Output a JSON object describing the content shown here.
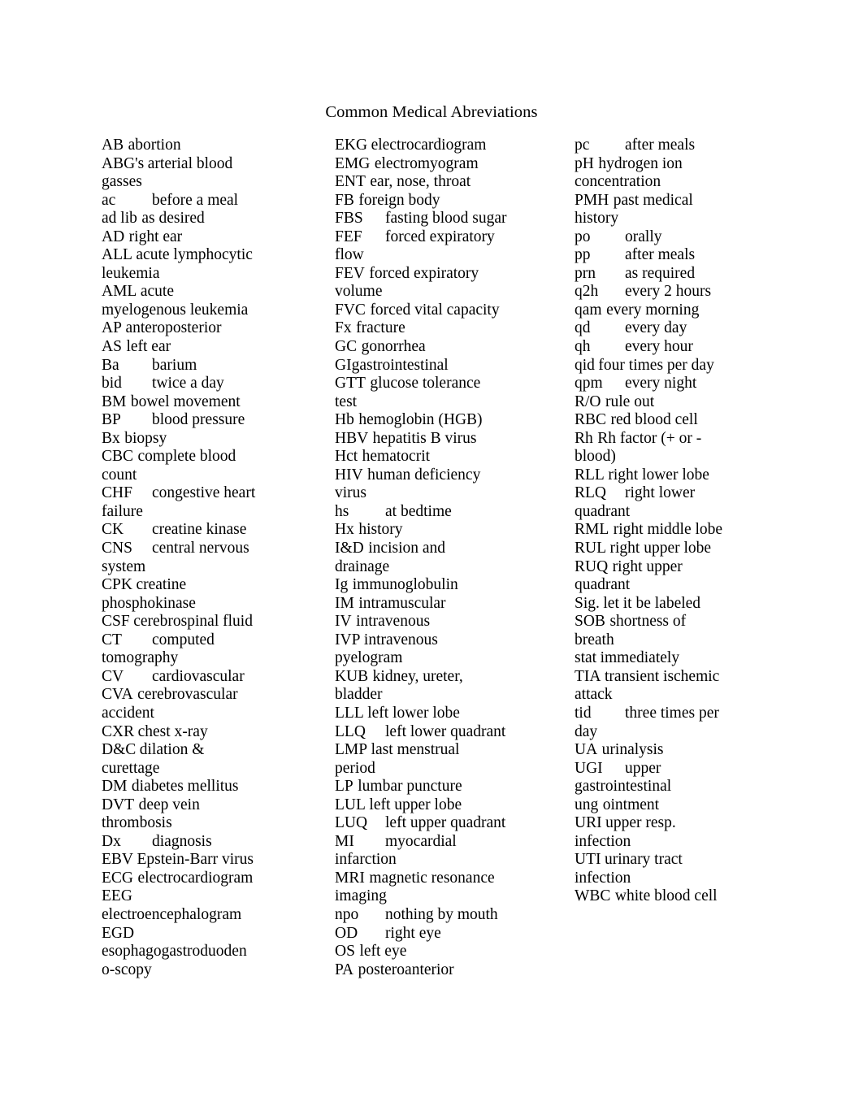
{
  "document": {
    "title": "Common Medical Abreviations",
    "page_background": "#ffffff",
    "text_color": "#000000"
  },
  "columns": [
    {
      "id": "column-1",
      "lines": [
        {
          "abbr": "AB",
          "definition": "abortion",
          "spacing": "tight"
        },
        {
          "abbr": "ABG's",
          "definition": "arterial blood",
          "spacing": "onespace"
        },
        {
          "continuation": "gasses"
        },
        {
          "abbr": "ac",
          "definition": "before a meal",
          "spacing": "tabbed"
        },
        {
          "abbr": "ad lib",
          "definition": "as desired",
          "spacing": "tight"
        },
        {
          "abbr": "AD",
          "definition": "right ear",
          "spacing": "tight"
        },
        {
          "abbr": "ALL",
          "definition": "acute lymphocytic",
          "spacing": "onespace"
        },
        {
          "continuation": "leukemia"
        },
        {
          "abbr": "AML",
          "definition": "acute",
          "spacing": "onespace"
        },
        {
          "continuation": "myelogenous leukemia"
        },
        {
          "abbr": "AP",
          "definition": "anteroposterior",
          "spacing": "onespace"
        },
        {
          "abbr": "AS",
          "definition": "left ear",
          "spacing": "tight"
        },
        {
          "abbr": "Ba",
          "definition": "barium",
          "spacing": "tabbed"
        },
        {
          "abbr": "bid",
          "definition": "twice a day",
          "spacing": "tabbed"
        },
        {
          "abbr": "BM",
          "definition": "bowel movement",
          "spacing": "tight"
        },
        {
          "abbr": "BP",
          "definition": "blood pressure",
          "spacing": "tabbed"
        },
        {
          "abbr": "Bx",
          "definition": "biopsy",
          "spacing": "tight"
        },
        {
          "abbr": "CBC",
          "definition": "complete blood",
          "spacing": "tight"
        },
        {
          "continuation": "count"
        },
        {
          "abbr": "CHF",
          "definition": "congestive heart",
          "spacing": "tabbed"
        },
        {
          "continuation": "failure"
        },
        {
          "abbr": "CK",
          "definition": "creatine kinase",
          "spacing": "tabbed"
        },
        {
          "abbr": "CNS",
          "definition": "central nervous",
          "spacing": "tabbed"
        },
        {
          "continuation": "system"
        },
        {
          "abbr": "CPK",
          "definition": "creatine",
          "spacing": "onespace"
        },
        {
          "continuation": "phosphokinase"
        },
        {
          "abbr": "CSF",
          "definition": "cerebrospinal fluid",
          "spacing": "onespace"
        },
        {
          "abbr": "CT",
          "definition": "computed",
          "spacing": "tabbed"
        },
        {
          "continuation": "tomography"
        },
        {
          "abbr": "CV",
          "definition": "cardiovascular",
          "spacing": "tabbed"
        },
        {
          "abbr": "CVA",
          "definition": "cerebrovascular",
          "spacing": "tight"
        },
        {
          "continuation": "accident"
        },
        {
          "abbr": "CXR",
          "definition": "chest x-ray",
          "spacing": "onespace"
        },
        {
          "abbr": "D&C",
          "definition": "dilation &",
          "spacing": "onespace"
        },
        {
          "continuation": "curettage"
        },
        {
          "abbr": "DM",
          "definition": "diabetes mellitus",
          "spacing": "tight"
        },
        {
          "abbr": "DVT",
          "definition": "deep vein",
          "spacing": "tight"
        },
        {
          "continuation": "thrombosis"
        },
        {
          "abbr": "Dx",
          "definition": "diagnosis",
          "spacing": "tabbed"
        },
        {
          "abbr": "EBV",
          "definition": "Epstein-Barr virus",
          "spacing": "onespace"
        },
        {
          "abbr": "ECG",
          "definition": "electrocardiogram",
          "spacing": "tight"
        },
        {
          "abbr": "EEG",
          "definition": "",
          "spacing": "nospace"
        },
        {
          "continuation": "electroencephalogram"
        },
        {
          "abbr": "EGD",
          "definition": "",
          "spacing": "nospace"
        },
        {
          "continuation": "esophagogastroduoden"
        },
        {
          "continuation": "o-scopy"
        }
      ]
    },
    {
      "id": "column-2",
      "lines": [
        {
          "abbr": "EKG",
          "definition": "electrocardiogram",
          "spacing": "onespace"
        },
        {
          "abbr": "EMG",
          "definition": "electromyogram",
          "spacing": "tight"
        },
        {
          "abbr": "ENT",
          "definition": "ear, nose, throat",
          "spacing": "tight"
        },
        {
          "abbr": "FB",
          "definition": "foreign body",
          "spacing": "tight"
        },
        {
          "abbr": "FBS",
          "definition": "fasting blood sugar",
          "spacing": "tabbed"
        },
        {
          "abbr": "FEF",
          "definition": "forced expiratory",
          "spacing": "tabbed"
        },
        {
          "continuation": "flow"
        },
        {
          "abbr": "FEV",
          "definition": "forced expiratory",
          "spacing": "tight"
        },
        {
          "continuation": "volume"
        },
        {
          "abbr": "FVC",
          "definition": "forced vital capacity",
          "spacing": "tight"
        },
        {
          "abbr": "Fx",
          "definition": "fracture",
          "spacing": "tight"
        },
        {
          "abbr": "GC",
          "definition": "gonorrhea",
          "spacing": "tight"
        },
        {
          "abbr": "GI",
          "definition": "gastrointestinal",
          "spacing": "nospace"
        },
        {
          "abbr": "GTT",
          "definition": "glucose tolerance",
          "spacing": "tight"
        },
        {
          "continuation": "test"
        },
        {
          "abbr": "Hb",
          "definition": "hemoglobin (HGB)",
          "spacing": "tight"
        },
        {
          "abbr": "HBV",
          "definition": "hepatitis B virus",
          "spacing": "tight"
        },
        {
          "abbr": "Hct",
          "definition": "hematocrit",
          "spacing": "tight"
        },
        {
          "abbr": "HIV",
          "definition": "human deficiency",
          "spacing": "tight"
        },
        {
          "continuation": "virus"
        },
        {
          "abbr": "hs",
          "definition": "at bedtime",
          "spacing": "tabbed"
        },
        {
          "abbr": "Hx",
          "definition": "history",
          "spacing": "tight"
        },
        {
          "abbr": "I&D",
          "definition": "incision and",
          "spacing": "tight"
        },
        {
          "continuation": "drainage"
        },
        {
          "abbr": "Ig",
          "definition": "immunoglobulin",
          "spacing": "tight"
        },
        {
          "abbr": "IM",
          "definition": "intramuscular",
          "spacing": "tight"
        },
        {
          "abbr": "IV",
          "definition": "intravenous",
          "spacing": "tight"
        },
        {
          "abbr": "IVP",
          "definition": "intravenous",
          "spacing": "onespace"
        },
        {
          "continuation": "pyelogram"
        },
        {
          "abbr": "KUB",
          "definition": "kidney, ureter,",
          "spacing": "tight"
        },
        {
          "continuation": "bladder"
        },
        {
          "abbr": "LLL",
          "definition": "left lower lobe",
          "spacing": "onespace"
        },
        {
          "abbr": "LLQ",
          "definition": "left lower quadrant",
          "spacing": "tabbed"
        },
        {
          "abbr": "LMP",
          "definition": "last menstrual",
          "spacing": "onespace"
        },
        {
          "continuation": "period"
        },
        {
          "abbr": "LP",
          "definition": "lumbar puncture",
          "spacing": "tight"
        },
        {
          "abbr": "LUL",
          "definition": "left upper lobe",
          "spacing": "onespace"
        },
        {
          "abbr": "LUQ",
          "definition": "left upper quadrant",
          "spacing": "tabbed"
        },
        {
          "abbr": "MI",
          "definition": "myocardial",
          "spacing": "tabbed"
        },
        {
          "continuation": "infarction"
        },
        {
          "abbr": "MRI",
          "definition": "magnetic resonance",
          "spacing": "tight"
        },
        {
          "continuation": "imaging"
        },
        {
          "abbr": "npo",
          "definition": "nothing by mouth",
          "spacing": "tabbed"
        },
        {
          "abbr": "OD",
          "definition": "right eye",
          "spacing": "tabbed"
        },
        {
          "abbr": "OS",
          "definition": "left eye",
          "spacing": "tight"
        },
        {
          "abbr": "PA",
          "definition": "posteroanterior",
          "spacing": "tight"
        }
      ]
    },
    {
      "id": "column-3",
      "lines": [
        {
          "abbr": "pc",
          "definition": "after meals",
          "spacing": "tabbed"
        },
        {
          "abbr": "pH",
          "definition": "hydrogen ion",
          "spacing": "tight"
        },
        {
          "continuation": "concentration"
        },
        {
          "abbr": "PMH",
          "definition": "past medical",
          "spacing": "tight"
        },
        {
          "continuation": "history"
        },
        {
          "abbr": "po",
          "definition": "orally",
          "spacing": "tabbed"
        },
        {
          "abbr": "pp",
          "definition": "after meals",
          "spacing": "tabbed"
        },
        {
          "abbr": "prn",
          "definition": "as required",
          "spacing": "tabbed"
        },
        {
          "abbr": "q2h",
          "definition": "every 2 hours",
          "spacing": "tabbed"
        },
        {
          "abbr": "qam",
          "definition": "every morning",
          "spacing": "tight"
        },
        {
          "abbr": "qd",
          "definition": "every day",
          "spacing": "tabbed"
        },
        {
          "abbr": "qh",
          "definition": "every hour",
          "spacing": "tabbed"
        },
        {
          "abbr": "qid",
          "definition": "four times per day",
          "spacing": "onespace"
        },
        {
          "abbr": "qpm",
          "definition": "every night",
          "spacing": "tabbed"
        },
        {
          "abbr": "R/O",
          "definition": "rule out",
          "spacing": "tight"
        },
        {
          "abbr": "RBC",
          "definition": "red blood cell",
          "spacing": "tight"
        },
        {
          "abbr": "Rh",
          "definition": "Rh factor (+ or -",
          "spacing": "tight"
        },
        {
          "continuation": "blood)"
        },
        {
          "abbr": "RLL",
          "definition": "right lower lobe",
          "spacing": "onespace"
        },
        {
          "abbr": "RLQ",
          "definition": "right lower",
          "spacing": "tabbed"
        },
        {
          "continuation": "quadrant"
        },
        {
          "abbr": "RML",
          "definition": "right middle lobe",
          "spacing": "tight"
        },
        {
          "abbr": "RUL",
          "definition": "right upper lobe",
          "spacing": "onespace"
        },
        {
          "abbr": "RUQ",
          "definition": "right upper",
          "spacing": "tight"
        },
        {
          "continuation": "quadrant"
        },
        {
          "abbr": "Sig.",
          "definition": "let it be labeled",
          "spacing": "onespace"
        },
        {
          "abbr": "SOB",
          "definition": "shortness of",
          "spacing": "tight"
        },
        {
          "continuation": "breath"
        },
        {
          "abbr": "stat",
          "definition": "immediately",
          "spacing": "onespace"
        },
        {
          "abbr": "TIA",
          "definition": "transient ischemic",
          "spacing": "onespace"
        },
        {
          "continuation": "attack"
        },
        {
          "abbr": "tid",
          "definition": "three times per",
          "spacing": "tabbed"
        },
        {
          "continuation": "day"
        },
        {
          "abbr": "UA",
          "definition": "urinalysis",
          "spacing": "tight"
        },
        {
          "abbr": "UGI",
          "definition": "upper",
          "spacing": "tabbed"
        },
        {
          "continuation": "gastrointestinal"
        },
        {
          "abbr": "ung",
          "definition": "ointment",
          "spacing": "tight"
        },
        {
          "abbr": "URI",
          "definition": "upper resp.",
          "spacing": "onespace"
        },
        {
          "continuation": "infection"
        },
        {
          "abbr": "UTI",
          "definition": "urinary tract",
          "spacing": "onespace"
        },
        {
          "continuation": "infection"
        },
        {
          "abbr": "WBC",
          "definition": "white blood cell",
          "spacing": "tight"
        }
      ]
    }
  ]
}
